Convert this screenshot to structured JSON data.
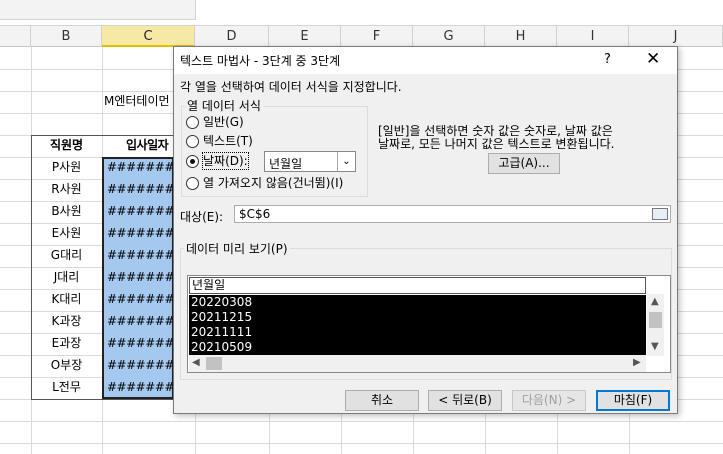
{
  "spreadsheet": {
    "columns": [
      "B",
      "C",
      "D",
      "E",
      "F",
      "G",
      "H",
      "I",
      "J"
    ],
    "selected_column": "C",
    "company_label": "M엔터테이먼",
    "header_b": "직원명",
    "header_c": "입사일자",
    "names": [
      "P사원",
      "R사원",
      "B사원",
      "E사원",
      "G대리",
      "J대리",
      "K대리",
      "K과장",
      "E과장",
      "O부장",
      "L전무"
    ],
    "hash_value": "########"
  },
  "dialog": {
    "title": "텍스트 마법사 - 3단계 중 3단계",
    "help": "?",
    "close": "✕",
    "instruction": "각 열을 선택하여 데이터 서식을 지정합니다.",
    "group_label": "열 데이터 서식",
    "options": {
      "general": "일반(G)",
      "text": "텍스트(T)",
      "date": "날짜(D):",
      "skip": "열 가져오지 않음(건너뜀)(I)"
    },
    "selected_option": "date",
    "date_format": "년월일",
    "description_line1": "[일반]을 선택하면 숫자 값은 숫자로, 날짜 값은",
    "description_line2": "날짜로, 모든 나머지 값은 텍스트로 변환됩니다.",
    "advanced_button": "고급(A)...",
    "destination_label": "대상(E):",
    "destination_value": "$C$6",
    "preview_label": "데이터 미리 보기(P)",
    "preview_header": "년월일",
    "preview_rows": [
      "20220308",
      "20211215",
      "20211111",
      "20210509"
    ],
    "buttons": {
      "cancel": "취소",
      "back": "< 뒤로(B)",
      "next": "다음(N) >",
      "finish": "마침(F)"
    }
  }
}
